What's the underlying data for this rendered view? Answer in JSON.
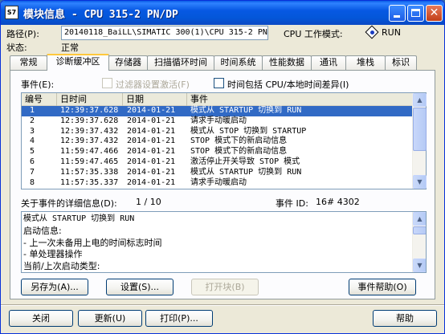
{
  "window": {
    "app_icon_text": "S7",
    "title": "模块信息 - CPU 315-2 PN/DP"
  },
  "info": {
    "path_label": "路径(P):",
    "path_value": "20140118_BaiLL\\SIMATIC 300(1)\\CPU 315-2 PN",
    "state_label": "状态:",
    "state_value": "正常",
    "mode_label": "CPU 工作模式:",
    "mode_value": "RUN"
  },
  "tabs": [
    {
      "label": "常规",
      "active": false
    },
    {
      "label": "诊断缓冲区",
      "active": true
    },
    {
      "label": "存储器",
      "active": false
    },
    {
      "label": "扫描循环时间",
      "active": false
    },
    {
      "label": "时间系统",
      "active": false
    },
    {
      "label": "性能数据",
      "active": false
    },
    {
      "label": "通讯",
      "active": false
    },
    {
      "label": "堆栈",
      "active": false
    },
    {
      "label": "标识",
      "active": false
    }
  ],
  "diag": {
    "events_label": "事件(E):",
    "filter_checkbox_label": "过滤器设置激活(F)",
    "cpu_time_checkbox_label": "时间包括 CPU/本地时间差异(I)",
    "columns": [
      "编号",
      "日时间",
      "日期",
      "事件"
    ],
    "rows": [
      {
        "no": "1",
        "time": "12:39:37.628",
        "date": "2014-01-21",
        "event": "模式从 STARTUP 切换到 RUN",
        "selected": true
      },
      {
        "no": "2",
        "time": "12:39:37.628",
        "date": "2014-01-21",
        "event": "请求手动暖启动",
        "selected": false
      },
      {
        "no": "3",
        "time": "12:39:37.432",
        "date": "2014-01-21",
        "event": "模式从 STOP 切换到 STARTUP",
        "selected": false
      },
      {
        "no": "4",
        "time": "12:39:37.432",
        "date": "2014-01-21",
        "event": "STOP 模式下的新启动信息",
        "selected": false
      },
      {
        "no": "5",
        "time": "11:59:47.466",
        "date": "2014-01-21",
        "event": "STOP 模式下的新启动信息",
        "selected": false
      },
      {
        "no": "6",
        "time": "11:59:47.465",
        "date": "2014-01-21",
        "event": "激活停止开关导致 STOP 模式",
        "selected": false
      },
      {
        "no": "7",
        "time": "11:57:35.338",
        "date": "2014-01-21",
        "event": "模式从 STARTUP 切换到 RUN",
        "selected": false
      },
      {
        "no": "8",
        "time": "11:57:35.337",
        "date": "2014-01-21",
        "event": "请求手动暖启动",
        "selected": false
      }
    ],
    "details_label": "关于事件的详细信息(D):",
    "details_position": "1 / 10",
    "event_id_label": "事件 ID:",
    "event_id_value": "16# 4302",
    "details_lines": [
      "模式从 STARTUP 切换到 RUN",
      "启动信息:",
      "- 上一次未备用上电的时间标志时间",
      "- 单处理器操作",
      "当前/上次启动类型:"
    ],
    "save_as_button": "另存为(A)...",
    "settings_button": "设置(S)...",
    "open_block_button": "打开块(B)",
    "event_help_button": "事件帮助(O)"
  },
  "footer": {
    "close_button": "关闭",
    "update_button": "更新(U)",
    "print_button": "打印(P)...",
    "help_button": "帮助"
  },
  "colors": {
    "titlebar": "#0758e3",
    "selection": "#316ac5",
    "active_tab_accent": "#ffc83c",
    "dialog_bg": "#ece9d8"
  }
}
